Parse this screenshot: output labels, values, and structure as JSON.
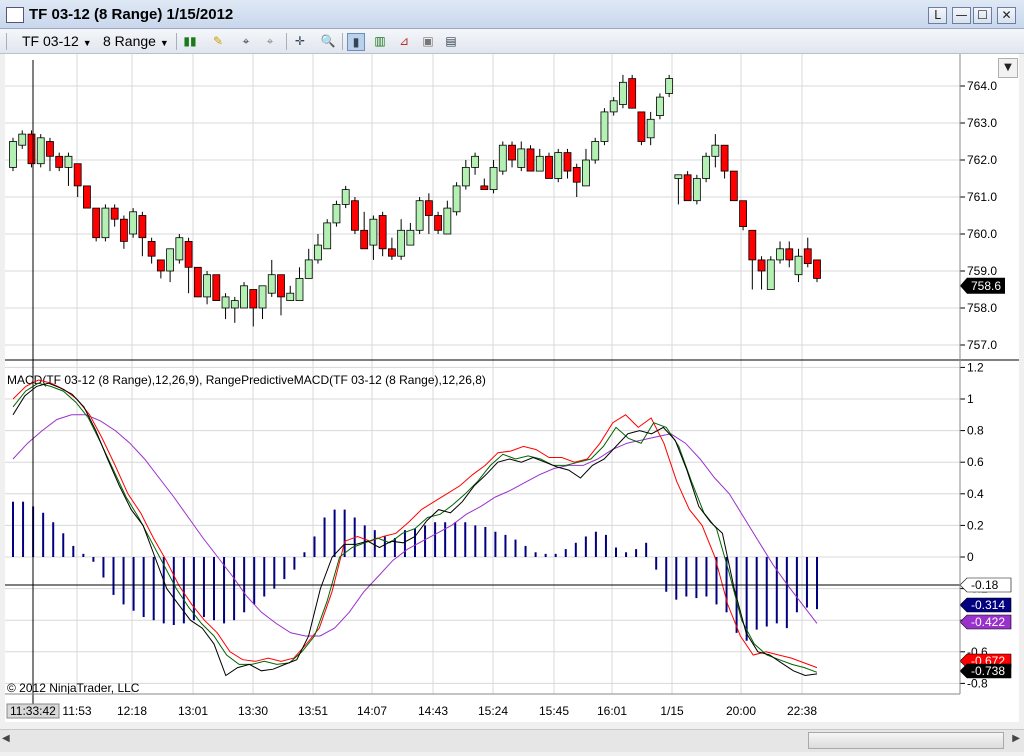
{
  "window": {
    "title": "TF 03-12 (8 Range)  1/15/2012",
    "buttons": [
      "L",
      "—",
      "☐",
      "✕"
    ]
  },
  "toolbar": {
    "instrument": "TF 03-12",
    "interval": "8 Range",
    "icons": [
      "bar-type-icon",
      "drawing-pencil-icon",
      "snap-icon",
      "global-draw-icon",
      "crosshair-icon",
      "zoom-icon",
      "chart-style-icon",
      "indicators-icon",
      "strategies-icon",
      "properties-icon",
      "data-box-icon"
    ]
  },
  "chart": {
    "price_axis": [
      "764.0",
      "763.0",
      "762.0",
      "761.0",
      "760.0",
      "759.0",
      "758.0",
      "757.0"
    ],
    "price_levels": [
      764,
      763,
      762,
      761,
      760,
      759,
      758,
      757
    ],
    "last_price": "758.6",
    "last_price_value": 758.6,
    "candles": [
      [
        761.8,
        762.5,
        761.7,
        762.6
      ],
      [
        762.4,
        762.7,
        762.3,
        762.8
      ],
      [
        762.7,
        761.9,
        761.8,
        762.8
      ],
      [
        761.9,
        762.6,
        761.8,
        762.7
      ],
      [
        762.5,
        762.1,
        761.7,
        762.6
      ],
      [
        762.1,
        761.8,
        761.7,
        762.2
      ],
      [
        761.8,
        762.1,
        761.3,
        762.2
      ],
      [
        761.9,
        761.3,
        761.0,
        761.9
      ],
      [
        761.3,
        760.7,
        760.7,
        761.3
      ],
      [
        760.7,
        759.9,
        759.8,
        760.7
      ],
      [
        759.9,
        760.7,
        759.8,
        760.8
      ],
      [
        760.7,
        760.4,
        760.2,
        760.8
      ],
      [
        760.4,
        759.8,
        759.6,
        760.5
      ],
      [
        760.0,
        760.6,
        759.9,
        760.7
      ],
      [
        760.5,
        759.9,
        759.4,
        760.6
      ],
      [
        759.8,
        759.4,
        759.2,
        759.9
      ],
      [
        759.3,
        759.0,
        758.8,
        759.3
      ],
      [
        759.0,
        759.6,
        758.7,
        759.6
      ],
      [
        759.3,
        759.9,
        759.2,
        760.0
      ],
      [
        759.8,
        759.1,
        758.4,
        759.9
      ],
      [
        759.1,
        758.3,
        758.3,
        759.1
      ],
      [
        758.3,
        758.9,
        758.1,
        759.0
      ],
      [
        758.9,
        758.2,
        758.2,
        758.9
      ],
      [
        758.0,
        758.3,
        757.7,
        758.4
      ],
      [
        758.0,
        758.2,
        757.6,
        758.3
      ],
      [
        758.0,
        758.6,
        758.0,
        758.7
      ],
      [
        758.5,
        758.0,
        757.5,
        758.5
      ],
      [
        758.0,
        758.6,
        757.7,
        758.6
      ],
      [
        758.4,
        758.9,
        758.3,
        759.3
      ],
      [
        758.9,
        758.3,
        757.8,
        758.9
      ],
      [
        758.2,
        758.4,
        758.3,
        758.6
      ],
      [
        758.2,
        758.8,
        758.2,
        759.1
      ],
      [
        758.8,
        759.3,
        758.9,
        759.6
      ],
      [
        759.3,
        759.7,
        759.2,
        760.0
      ],
      [
        759.6,
        760.3,
        759.7,
        760.4
      ],
      [
        760.3,
        760.8,
        760.2,
        760.9
      ],
      [
        760.8,
        761.2,
        760.7,
        761.3
      ],
      [
        760.9,
        760.1,
        760.0,
        761.0
      ],
      [
        760.1,
        759.6,
        759.8,
        760.6
      ],
      [
        759.7,
        760.4,
        759.3,
        760.5
      ],
      [
        760.5,
        759.6,
        759.4,
        760.6
      ],
      [
        759.6,
        759.4,
        759.3,
        759.9
      ],
      [
        759.4,
        760.1,
        759.3,
        760.4
      ],
      [
        759.7,
        760.1,
        759.8,
        760.3
      ],
      [
        760.1,
        760.9,
        760.0,
        761.0
      ],
      [
        760.9,
        760.5,
        760.0,
        761.1
      ],
      [
        760.5,
        760.1,
        760.0,
        760.6
      ],
      [
        760.0,
        760.7,
        760.0,
        760.9
      ],
      [
        760.6,
        761.3,
        760.5,
        761.4
      ],
      [
        761.3,
        761.8,
        761.2,
        762.0
      ],
      [
        761.8,
        762.1,
        761.6,
        762.2
      ],
      [
        761.3,
        761.2,
        761.2,
        761.5
      ],
      [
        761.2,
        761.8,
        761.1,
        762.0
      ],
      [
        761.7,
        762.4,
        761.6,
        762.5
      ],
      [
        762.4,
        762.0,
        761.8,
        762.5
      ],
      [
        761.8,
        762.3,
        761.7,
        762.5
      ],
      [
        762.3,
        761.7,
        761.7,
        762.4
      ],
      [
        761.7,
        762.1,
        761.7,
        762.3
      ],
      [
        762.1,
        761.5,
        761.5,
        762.2
      ],
      [
        761.5,
        762.2,
        761.4,
        762.3
      ],
      [
        762.2,
        761.7,
        761.5,
        762.3
      ],
      [
        761.8,
        761.4,
        761.0,
        761.9
      ],
      [
        761.3,
        762.0,
        761.3,
        762.3
      ],
      [
        762.0,
        762.5,
        761.9,
        762.6
      ],
      [
        762.5,
        763.3,
        762.4,
        763.4
      ],
      [
        763.3,
        763.6,
        763.2,
        763.7
      ],
      [
        763.5,
        764.1,
        763.4,
        764.3
      ],
      [
        764.2,
        763.4,
        763.4,
        764.3
      ],
      [
        763.3,
        762.5,
        762.4,
        763.3
      ],
      [
        762.6,
        763.1,
        762.4,
        763.3
      ],
      [
        763.2,
        763.7,
        763.1,
        763.8
      ],
      [
        763.8,
        764.2,
        763.7,
        764.3
      ],
      [
        761.5,
        761.6,
        760.8,
        761.6
      ],
      [
        761.6,
        760.9,
        760.9,
        761.7
      ],
      [
        760.9,
        761.5,
        760.8,
        761.6
      ],
      [
        761.5,
        762.1,
        761.4,
        762.2
      ],
      [
        762.1,
        762.4,
        761.8,
        762.7
      ],
      [
        762.4,
        761.7,
        761.5,
        762.4
      ],
      [
        761.7,
        760.9,
        760.9,
        761.7
      ],
      [
        760.9,
        760.2,
        760.1,
        760.9
      ],
      [
        760.1,
        759.3,
        758.5,
        760.1
      ],
      [
        759.3,
        759.0,
        758.5,
        759.4
      ],
      [
        758.5,
        759.3,
        758.5,
        759.4
      ],
      [
        759.3,
        759.6,
        759.2,
        759.8
      ],
      [
        759.6,
        759.3,
        759.1,
        759.8
      ],
      [
        758.9,
        759.4,
        758.7,
        759.6
      ],
      [
        759.6,
        759.2,
        759.1,
        759.9
      ],
      [
        759.3,
        758.8,
        758.7,
        759.3
      ]
    ],
    "candle_pattern": "0-3: 4 bars, then gap, rest",
    "macd_label": "MACD(TF  03-12  (8  Range),12,26,9),  RangePredictiveMACD(TF  03-12  (8  Range),12,26,8)",
    "macd_axis": [
      "1.2",
      "1",
      "0.8",
      "0.6",
      "0.4",
      "0.2",
      "0",
      "-0.2",
      "-0.4",
      "-0.6",
      "-0.8"
    ],
    "macd_levels": [
      1.2,
      1,
      0.8,
      0.6,
      0.4,
      0.2,
      0,
      -0.2,
      -0.4,
      -0.6,
      -0.8
    ],
    "macd_markers": [
      {
        "text": "-0.18",
        "value": -0.18,
        "bg": "#ffffff",
        "fg": "#000000"
      },
      {
        "text": "-0.314",
        "value": -0.314,
        "bg": "#000080",
        "fg": "#ffffff"
      },
      {
        "text": "-0.422",
        "value": -0.422,
        "bg": "#9932cc",
        "fg": "#ffffff"
      },
      {
        "text": "-0.672",
        "value": -0.672,
        "bg": "#ff0000",
        "fg": "#ffffff"
      },
      {
        "text": "-0.738",
        "value": -0.738,
        "bg": "#000000",
        "fg": "#ffffff"
      }
    ],
    "histogram": [
      0.35,
      0.35,
      0.32,
      0.28,
      0.22,
      0.15,
      0.07,
      0.02,
      -0.03,
      -0.13,
      -0.24,
      -0.3,
      -0.34,
      -0.38,
      -0.4,
      -0.42,
      -0.43,
      -0.42,
      -0.4,
      -0.38,
      -0.4,
      -0.42,
      -0.4,
      -0.35,
      -0.3,
      -0.25,
      -0.2,
      -0.14,
      -0.08,
      0.03,
      0.13,
      0.25,
      0.3,
      0.3,
      0.25,
      0.2,
      0.17,
      0.13,
      0.12,
      0.17,
      0.18,
      0.2,
      0.22,
      0.22,
      0.22,
      0.22,
      0.2,
      0.19,
      0.16,
      0.14,
      0.11,
      0.07,
      0.03,
      0.02,
      0.02,
      0.05,
      0.09,
      0.13,
      0.16,
      0.14,
      0.06,
      0.03,
      0.05,
      0.09,
      -0.08,
      -0.22,
      -0.27,
      -0.25,
      -0.26,
      -0.25,
      -0.3,
      -0.35,
      -0.48,
      -0.53,
      -0.46,
      -0.44,
      -0.42,
      -0.45,
      -0.35,
      -0.32,
      -0.33
    ],
    "macd_line": [
      0.9,
      1.02,
      1.08,
      1.1,
      1.07,
      1.03,
      0.95,
      0.8,
      0.62,
      0.45,
      0.3,
      0.2,
      0.0,
      -0.2,
      -0.3,
      -0.4,
      -0.45,
      -0.55,
      -0.75,
      -0.7,
      -0.68,
      -0.72,
      -0.71,
      -0.68,
      -0.65,
      -0.5,
      -0.2,
      0.0,
      0.08,
      0.08,
      0.1,
      0.06,
      0.1,
      0.09,
      0.13,
      0.23,
      0.3,
      0.28,
      0.35,
      0.45,
      0.52,
      0.6,
      0.62,
      0.6,
      0.63,
      0.6,
      0.57,
      0.55,
      0.5,
      0.58,
      0.62,
      0.7,
      0.78,
      0.8,
      0.78,
      0.82,
      0.74,
      0.55,
      0.32,
      0.22,
      0.15,
      -0.2,
      -0.48,
      -0.6,
      -0.62,
      -0.67,
      -0.72,
      -0.75,
      -0.74
    ],
    "macd_line_green": [
      0.95,
      1.05,
      1.1,
      1.08,
      1.05,
      0.98,
      0.88,
      0.72,
      0.55,
      0.38,
      0.25,
      0.1,
      -0.05,
      -0.2,
      -0.32,
      -0.42,
      -0.5,
      -0.62,
      -0.68,
      -0.68,
      -0.66,
      -0.68,
      -0.67,
      -0.6,
      -0.5,
      -0.28,
      0.0,
      0.06,
      0.09,
      0.12,
      0.09,
      0.15,
      0.18,
      0.25,
      0.27,
      0.33,
      0.4,
      0.48,
      0.58,
      0.65,
      0.62,
      0.64,
      0.62,
      0.58,
      0.58,
      0.6,
      0.62,
      0.7,
      0.82,
      0.75,
      0.72,
      0.85,
      0.82,
      0.7,
      0.48,
      0.28,
      0.18,
      -0.1,
      -0.4,
      -0.55,
      -0.62,
      -0.65,
      -0.68,
      -0.7,
      -0.73
    ],
    "macd_line_red": [
      1.0,
      1.08,
      1.12,
      1.1,
      1.06,
      1.0,
      0.9,
      0.75,
      0.58,
      0.4,
      0.28,
      0.12,
      -0.02,
      -0.18,
      -0.3,
      -0.4,
      -0.48,
      -0.6,
      -0.65,
      -0.66,
      -0.64,
      -0.66,
      -0.64,
      -0.55,
      -0.45,
      -0.22,
      0.1,
      0.13,
      0.1,
      0.13,
      0.15,
      0.22,
      0.3,
      0.35,
      0.4,
      0.45,
      0.52,
      0.58,
      0.66,
      0.67,
      0.7,
      0.68,
      0.63,
      0.63,
      0.6,
      0.62,
      0.72,
      0.85,
      0.9,
      0.82,
      0.88,
      0.72,
      0.48,
      0.3,
      0.2,
      0.0,
      -0.3,
      -0.5,
      -0.62,
      -0.6,
      -0.62,
      -0.64,
      -0.67,
      -0.7
    ],
    "signal_line": [
      0.62,
      0.72,
      0.8,
      0.87,
      0.9,
      0.9,
      0.86,
      0.8,
      0.72,
      0.62,
      0.5,
      0.38,
      0.25,
      0.12,
      0.0,
      -0.12,
      -0.25,
      -0.35,
      -0.42,
      -0.48,
      -0.5,
      -0.5,
      -0.45,
      -0.35,
      -0.22,
      -0.12,
      -0.02,
      0.05,
      0.1,
      0.15,
      0.2,
      0.27,
      0.32,
      0.38,
      0.42,
      0.47,
      0.52,
      0.56,
      0.58,
      0.58,
      0.62,
      0.68,
      0.72,
      0.74,
      0.76,
      0.78,
      0.72,
      0.62,
      0.5,
      0.4,
      0.25,
      0.1,
      -0.05,
      -0.18,
      -0.3,
      -0.42
    ],
    "crosshair_time": "11:33:42",
    "time_axis": [
      "11:53",
      "12:18",
      "13:01",
      "13:30",
      "13:51",
      "14:07",
      "14:43",
      "15:24",
      "15:45",
      "16:01",
      "1/15",
      "20:00",
      "22:38"
    ],
    "copyright": "© 2012 NinjaTrader, LLC",
    "colors": {
      "up": "#b4f0b4",
      "down": "#ff0000",
      "macd": "#000000",
      "macd_green": "#006400",
      "macd_red": "#ff0000",
      "signal": "#9932cc",
      "hist": "#000080",
      "grid": "#d8d8d8"
    }
  }
}
